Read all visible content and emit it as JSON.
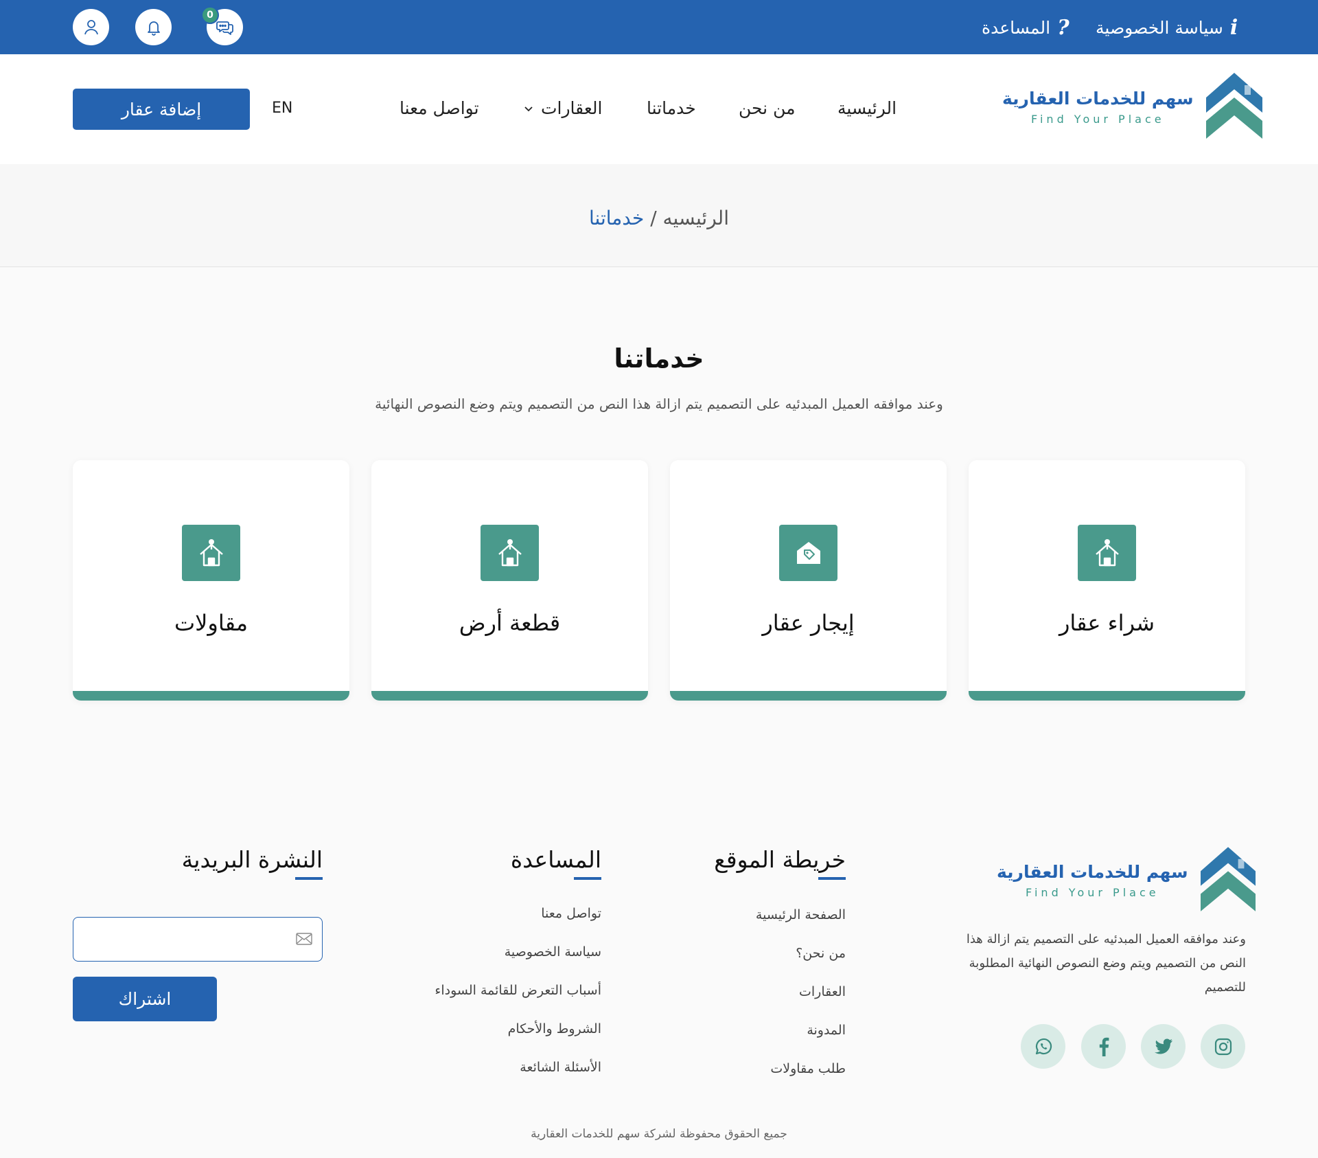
{
  "topbar": {
    "privacy_label": "سياسة الخصوصية",
    "help_label": "المساعدة",
    "messages_count": "0",
    "icons": [
      "chat-icon",
      "bell-icon",
      "user-icon",
      "info-icon",
      "question-icon"
    ]
  },
  "brand": {
    "name": "سهم للخدمات العقارية",
    "tagline": "Find Your Place",
    "colors": {
      "primary": "#2563b0",
      "accent": "#4a9a8c"
    }
  },
  "nav": {
    "home": "الرئيسية",
    "about": "من نحن",
    "services": "خدماتنا",
    "properties": "العقارات",
    "contact": "تواصل معنا",
    "lang": "EN",
    "add_property": "إضافة عقار"
  },
  "breadcrumb": {
    "home": "الرئيسيه",
    "sep": "/",
    "current": "خدماتنا"
  },
  "services": {
    "title": "خدماتنا",
    "subtitle": "وعند موافقه العميل المبدئيه على التصميم يتم ازالة هذا النص من التصميم ويتم وضع النصوص النهائية",
    "cards": [
      {
        "label": "شراء عقار",
        "icon": "house-key-icon"
      },
      {
        "label": "إيجار عقار",
        "icon": "house-tag-icon"
      },
      {
        "label": "قطعة أرض",
        "icon": "house-key-icon"
      },
      {
        "label": "مقاولات",
        "icon": "house-key-icon"
      }
    ]
  },
  "footer": {
    "about": "وعند موافقه العميل المبدئيه على التصميم يتم ازالة هذا النص من التصميم ويتم وضع النصوص النهائية المطلوبة للتصميم",
    "sitemap": {
      "title": "خريطة الموقع",
      "links": [
        "الصفحة الرئيسية",
        "من نحن؟",
        "العقارات",
        "المدونة",
        "طلب مقاولات"
      ]
    },
    "help": {
      "title": "المساعدة",
      "links": [
        "تواصل معنا",
        "سياسة الخصوصية",
        "أسباب التعرض للقائمة السوداء",
        "الشروط والأحكام",
        "الأسئلة الشائعة"
      ]
    },
    "newsletter": {
      "title": "النشرة البريدية",
      "email_value": "",
      "subscribe": "اشتراك"
    },
    "social": [
      "instagram-icon",
      "twitter-icon",
      "facebook-icon",
      "whatsapp-icon"
    ],
    "copyright": "جميع الحقوق محفوظة لشركة سهم للخدمات العقارية"
  }
}
